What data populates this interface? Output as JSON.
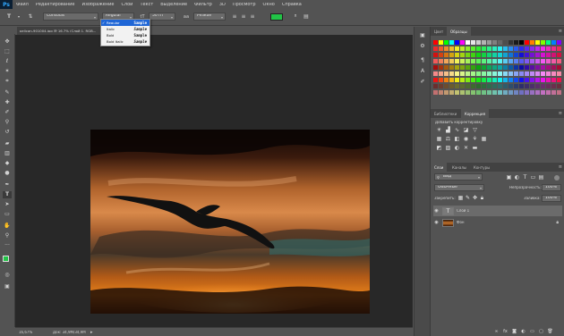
{
  "app": {
    "logo": "Ps"
  },
  "menubar": {
    "items": [
      "Файл",
      "Редактирование",
      "Изображение",
      "Слои",
      "Текст",
      "Выделение",
      "Фильтр",
      "3D",
      "Просмотр",
      "Окно",
      "Справка"
    ]
  },
  "options_bar": {
    "font_family": "Consolas",
    "font_style": "Regular",
    "font_size": "50 пт",
    "antialias": "Резкое",
    "text_color": "#22c447"
  },
  "font_style_menu": {
    "items": [
      {
        "label": "Regular",
        "sample": "Sample",
        "selected": true
      },
      {
        "label": "Italic",
        "sample": "Sample",
        "selected": false
      },
      {
        "label": "Bold",
        "sample": "Sample",
        "selected": false
      },
      {
        "label": "Bold Italic",
        "sample": "Sample",
        "selected": false
      }
    ]
  },
  "document": {
    "tab_title": "pelican-901004.jpg @ 16,7% (Слой 1, RGB..."
  },
  "status": {
    "zoom": "16,67%",
    "doc_size": "Док: 34,9М/34,9М"
  },
  "colors": {
    "foreground": "#22c447",
    "background": "#ffffff"
  },
  "swatches_panel": {
    "tabs": [
      "Цвет",
      "Образцы"
    ],
    "active_tab": "Образцы"
  },
  "adjustments_panel": {
    "tabs": [
      "Библиотеки",
      "Коррекция"
    ],
    "active_tab": "Коррекция",
    "heading": "Добавить корректировку"
  },
  "layers_panel": {
    "tabs": [
      "Слои",
      "Каналы",
      "Контуры"
    ],
    "active_tab": "Слои",
    "filter_kind": "Вид",
    "blend_mode": "Обычные",
    "opacity_label": "Непрозрачность:",
    "opacity_value": "100%",
    "lock_label": "Закрепить:",
    "fill_label": "Заливка:",
    "fill_value": "100%",
    "layers": [
      {
        "name": "Слой 1",
        "type": "text",
        "selected": true
      },
      {
        "name": "Фон",
        "type": "image",
        "selected": false
      }
    ]
  }
}
